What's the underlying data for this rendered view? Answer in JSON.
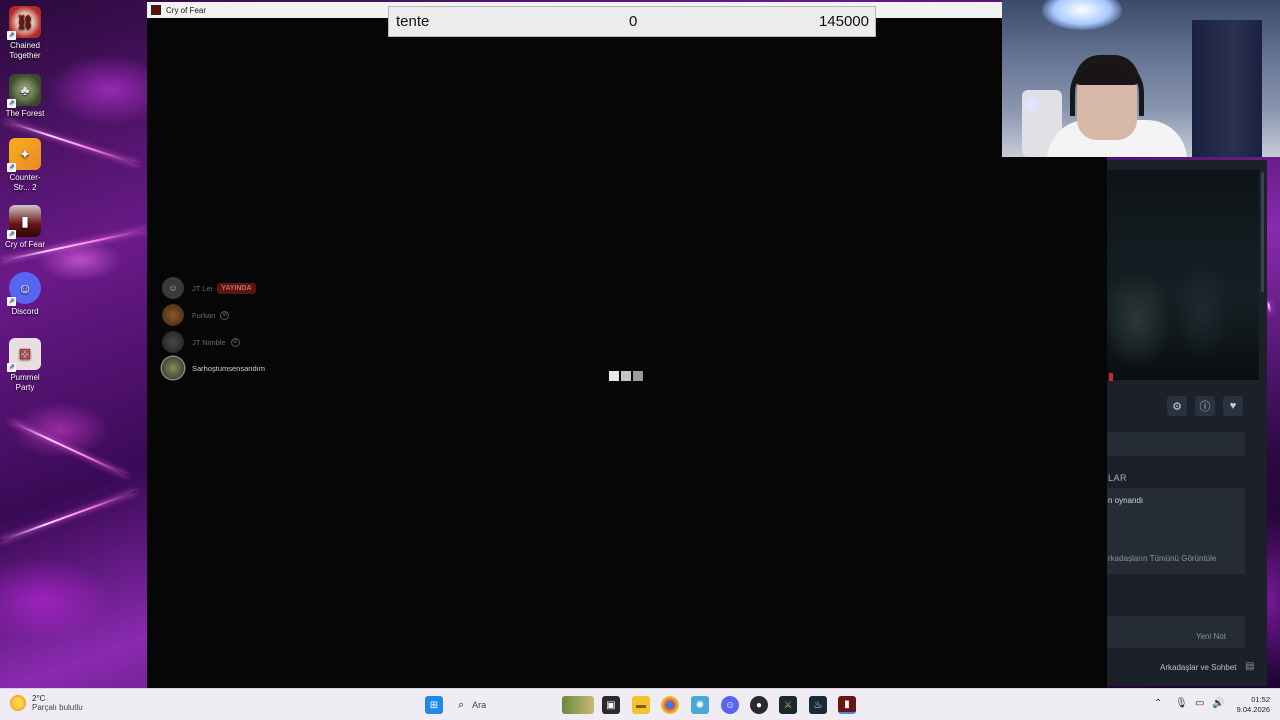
{
  "desktop": {
    "icons": [
      {
        "label": "Chained Together",
        "icon": "chained-together-icon"
      },
      {
        "label": "The Forest",
        "icon": "the-forest-icon"
      },
      {
        "label": "Counter-Str... 2",
        "icon": "counter-strike-icon"
      },
      {
        "label": "Cry of Fear",
        "icon": "cry-of-fear-icon"
      },
      {
        "label": "Discord",
        "icon": "discord-icon"
      },
      {
        "label": "Pummel Party",
        "icon": "pummel-party-icon"
      }
    ]
  },
  "game_window": {
    "title": "Cry of Fear"
  },
  "score_bar": {
    "name": "tente",
    "current": "0",
    "goal": "145000"
  },
  "voice_overlay": {
    "users": [
      {
        "name": "JT Lei",
        "badge": "YAYINDA",
        "speaking": false
      },
      {
        "name": "Furkan",
        "badge": "",
        "speaking": false
      },
      {
        "name": "JT Nimble",
        "badge": "",
        "speaking": false
      },
      {
        "name": "Sarhoştumsensandım",
        "badge": "",
        "speaking": true
      }
    ]
  },
  "steam_panel": {
    "section_label": "LAR",
    "played_text": "n oynandı",
    "view_all_friends": "rkadaşların Tümünü Görüntüle",
    "new_note": "Yeni Not",
    "friends_chat": "Arkadaşlar ve Sohbet"
  },
  "taskbar": {
    "weather_temp": "2°C",
    "weather_condition": "Parçalı bulutlu",
    "search_placeholder": "Ara",
    "time": "01:52",
    "date": "9.04.2026"
  },
  "colors": {
    "wallpaper_accent": "#8a2ab0",
    "taskbar_bg": "#f0ecf4",
    "live_badge": "#5a1414",
    "steam_panel_bg": "#1c2028"
  }
}
